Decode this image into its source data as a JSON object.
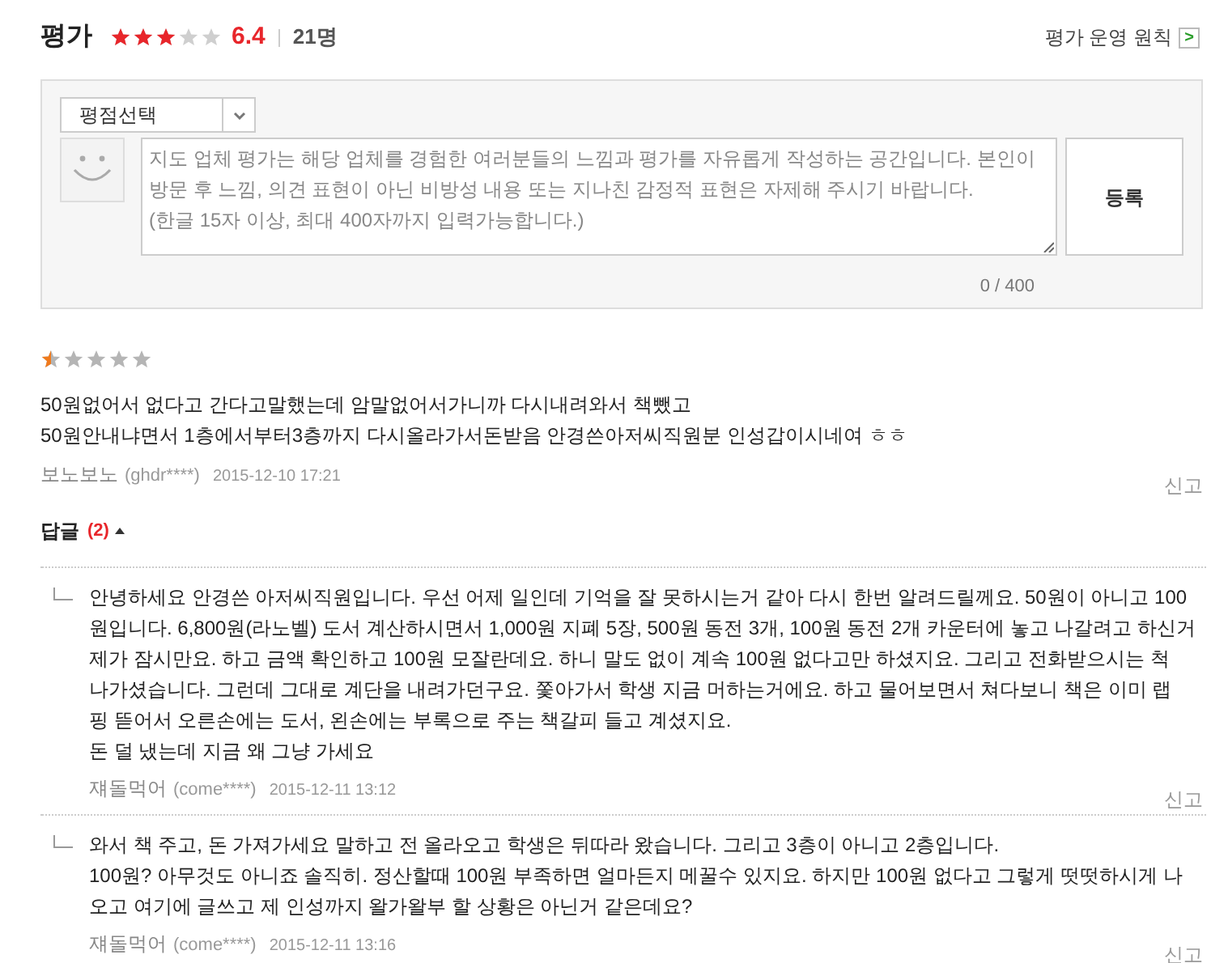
{
  "header": {
    "title": "평가",
    "stars": 3,
    "score": "6.4",
    "count": "21명",
    "policy_link": "평가 운영 원칙",
    "policy_arrow": ">"
  },
  "form": {
    "select": "평점선택",
    "textarea_placeholder_lines": [
      "지도 업체 평가는 해당 업체를 경험한 여러분들의 느낌과 평가를 자유롭게 작성하는 공간입니다. 본인이",
      "방문 후 느낌, 의견 표현이 아닌 비방성 내용 또는 지나친 감정적 표현은 자제해 주시기 바랍니다.",
      "(한글 15자 이상, 최대 400자까지 입력가능합니다.)"
    ],
    "submit": "등록",
    "counter": "0 / 400"
  },
  "review": {
    "stars": 0.5,
    "lines": [
      "50원없어서 없다고 간다고말했는데 암말없어서가니까 다시내려와서 책뺐고",
      "50원안내냐면서 1층에서부터3층까지 다시올라가서돈받음 안경쓴아저씨직원분 인성갑이시네여 ㅎㅎ"
    ],
    "author": "보노보노",
    "user_id": "(ghdr****)",
    "date": "2015-12-10 17:21",
    "report": "신고"
  },
  "replies_toggle": {
    "label": "답글",
    "count": "(2)",
    "expanded": true
  },
  "replies": [
    {
      "lines": [
        "안녕하세요 안경쓴 아저씨직원입니다. 우선 어제 일인데 기억을 잘 못하시는거 같아 다시 한번 알려드릴께요. 50원이 아니고 100",
        "원입니다. 6,800원(라노벨) 도서 계산하시면서 1,000원 지폐 5장, 500원 동전 3개, 100원 동전 2개 카운터에 놓고 나갈려고 하신거",
        "제가 잠시만요. 하고 금액 확인하고 100원 모잘란데요. 하니 말도 없이 계속 100원 없다고만 하셨지요. 그리고 전화받으시는 척",
        "나가셨습니다. 그런데 그대로 계단을 내려가던구요. 쫓아가서 학생 지금 머하는거에요. 하고 물어보면서 쳐다보니 책은 이미 랩",
        "핑 뜯어서 오른손에는 도서, 왼손에는 부록으로 주는 책갈피 들고 계셨지요.",
        "돈 덜 냈는데 지금 왜 그냥 가세요"
      ],
      "author": "쟤돌먹어",
      "user_id": "(come****)",
      "date": "2015-12-11 13:12",
      "report": "신고"
    },
    {
      "lines": [
        "와서 책 주고, 돈 가져가세요 말하고 전 올라오고 학생은 뒤따라 왔습니다. 그리고 3층이 아니고 2층입니다.",
        "100원? 아무것도 아니죠 솔직히. 정산할때 100원 부족하면 얼마든지 메꿀수 있지요. 하지만 100원 없다고 그렇게 떳떳하시게 나",
        "오고 여기에 글쓰고 제 인성까지 왈가왈부 할 상황은 아닌거 같은데요?"
      ],
      "author": "쟤돌먹어",
      "user_id": "(come****)",
      "date": "2015-12-11 13:16",
      "report": "신고"
    }
  ]
}
